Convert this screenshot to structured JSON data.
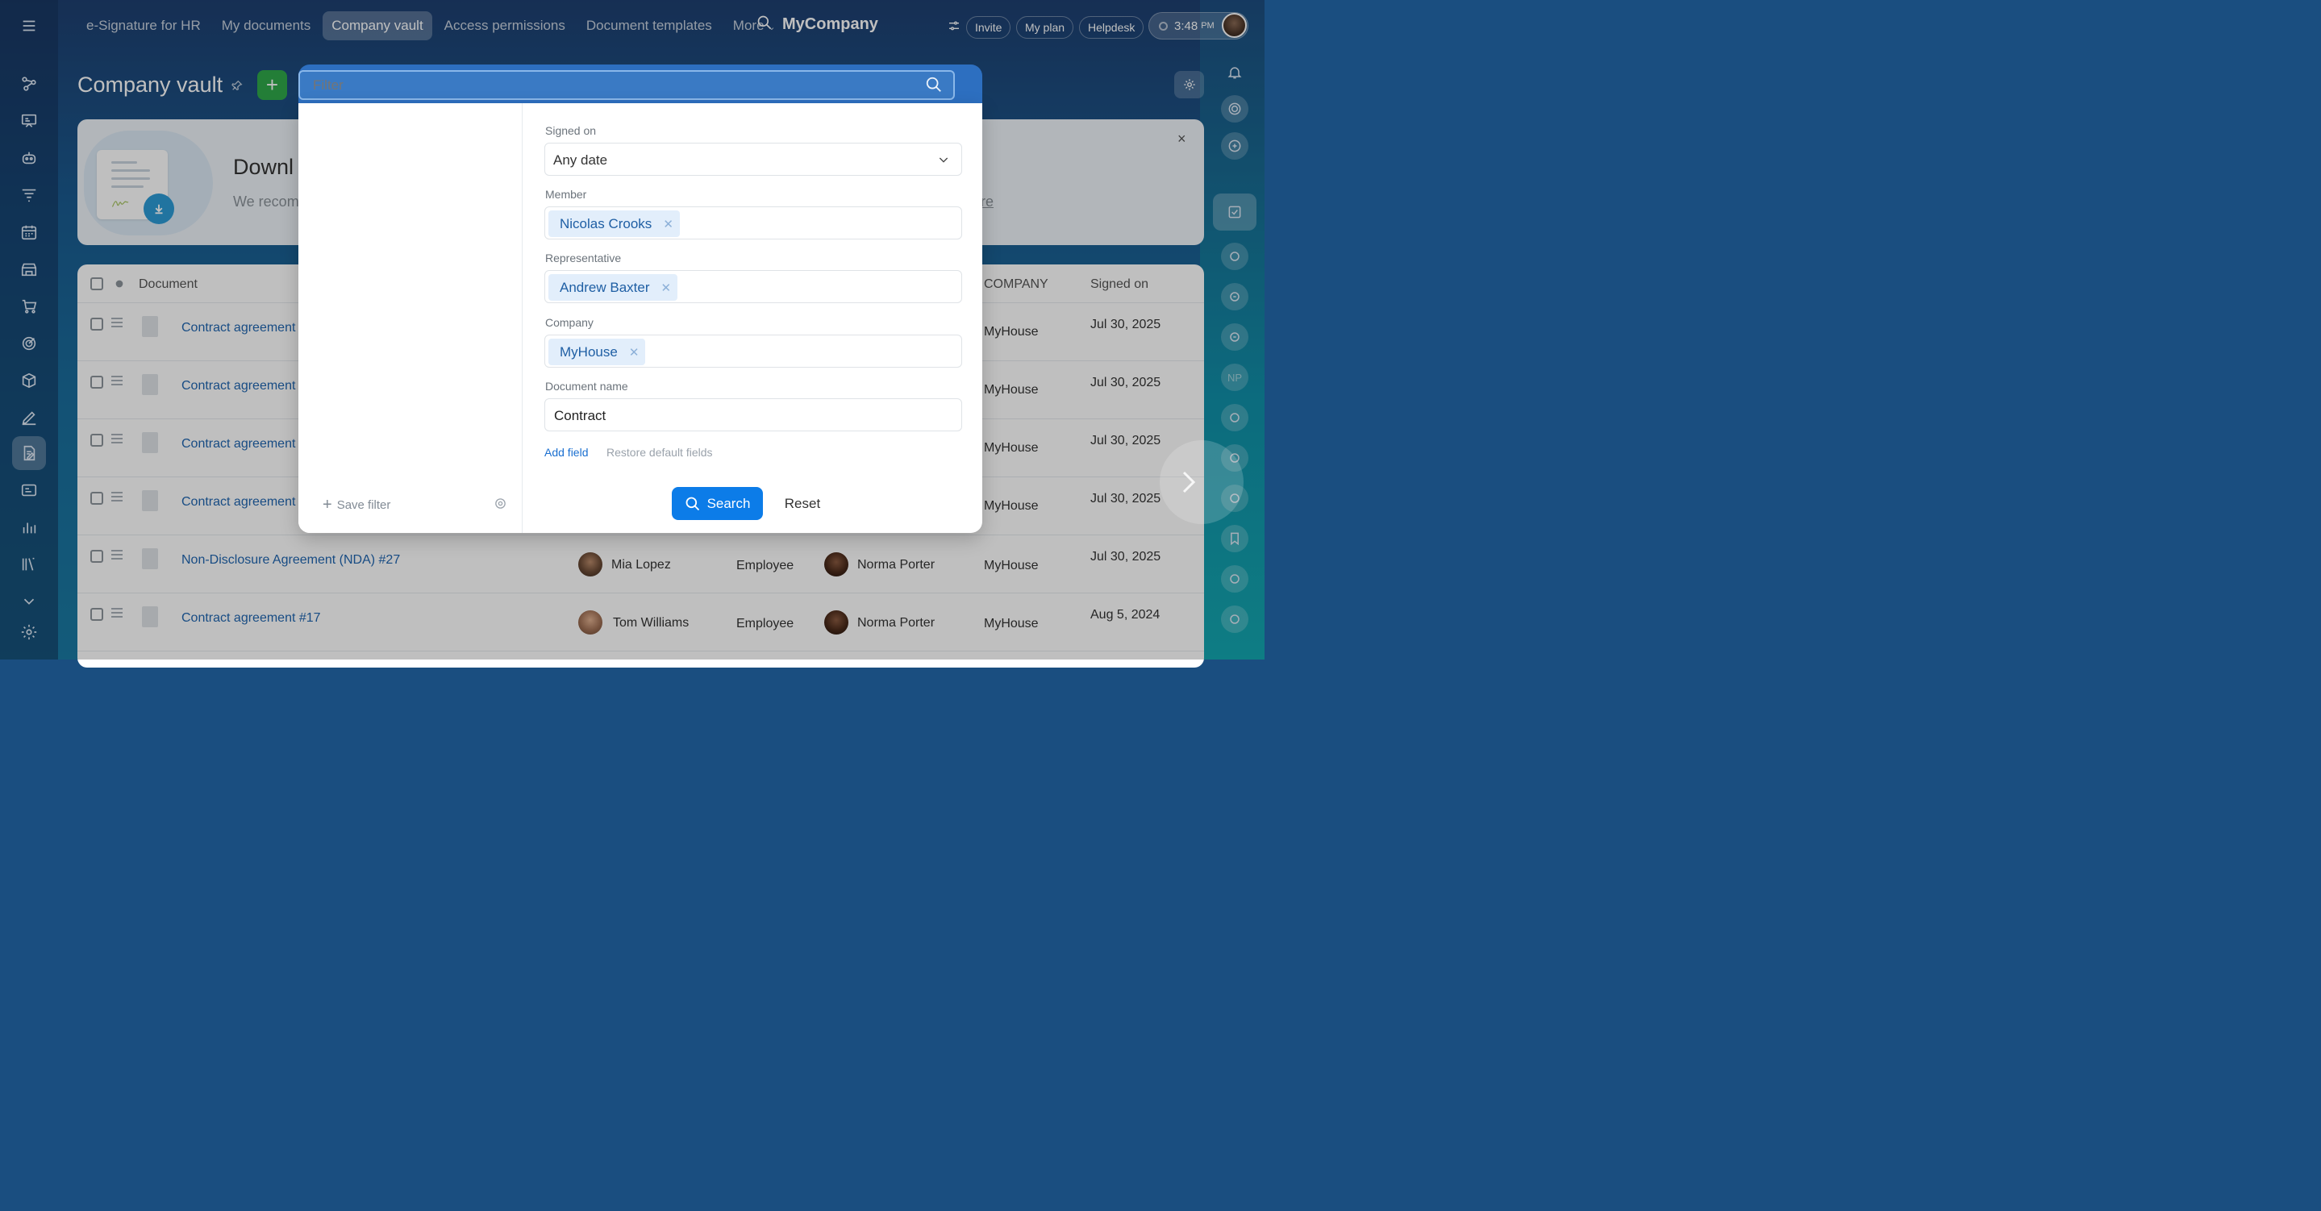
{
  "nav": {
    "items": [
      "e-Signature for HR",
      "My documents",
      "Company vault",
      "Access permissions",
      "Document templates",
      "More"
    ],
    "active": "Company vault",
    "brand": "MyCompany",
    "invite": "Invite",
    "my_plan": "My plan",
    "helpdesk": "Helpdesk",
    "time": "3:48",
    "ampm": "PM"
  },
  "page": {
    "title": "Company vault",
    "add_label": "+"
  },
  "banner": {
    "title": "Downl",
    "description": "We recom",
    "link": "re",
    "close": "×"
  },
  "table": {
    "columns": {
      "document": "Document",
      "company": "COMPANY",
      "signed_on": "Signed on"
    },
    "rows": [
      {
        "name": "Contract agreement",
        "member": "",
        "role": "",
        "representative": "",
        "company": "MyHouse",
        "date": "Jul 30, 2025"
      },
      {
        "name": "Contract agreement",
        "member": "",
        "role": "",
        "representative": "",
        "company": "MyHouse",
        "date": "Jul 30, 2025"
      },
      {
        "name": "Contract agreement",
        "member": "",
        "role": "",
        "representative": "",
        "company": "MyHouse",
        "date": "Jul 30, 2025"
      },
      {
        "name": "Contract agreement",
        "member": "",
        "role": "",
        "representative": "",
        "company": "MyHouse",
        "date": "Jul 30, 2025"
      },
      {
        "name": "Non-Disclosure Agreement (NDA) #27",
        "member": "Mia Lopez",
        "role": "Employee",
        "representative": "Norma Porter",
        "company": "MyHouse",
        "date": "Jul 30, 2025"
      },
      {
        "name": "Contract agreement #17",
        "member": "Tom Williams",
        "role": "Employee",
        "representative": "Norma Porter",
        "company": "MyHouse",
        "date": "Aug 5, 2024"
      }
    ]
  },
  "filter": {
    "placeholder": "Filter",
    "save_filter": "Save filter",
    "signed_on_label": "Signed on",
    "signed_on_value": "Any date",
    "member_label": "Member",
    "member_tag": "Nicolas Crooks",
    "representative_label": "Representative",
    "representative_tag": "Andrew Baxter",
    "company_label": "Company",
    "company_tag": "MyHouse",
    "document_name_label": "Document name",
    "document_name_value": "Contract",
    "add_field": "Add field",
    "restore_default": "Restore default fields",
    "search": "Search",
    "reset": "Reset"
  },
  "right_sidebar": {
    "initials": "NP"
  },
  "colors": {
    "accent_blue": "#0c7ce8",
    "add_green": "#2fa84a",
    "link_blue": "#2066b0"
  }
}
